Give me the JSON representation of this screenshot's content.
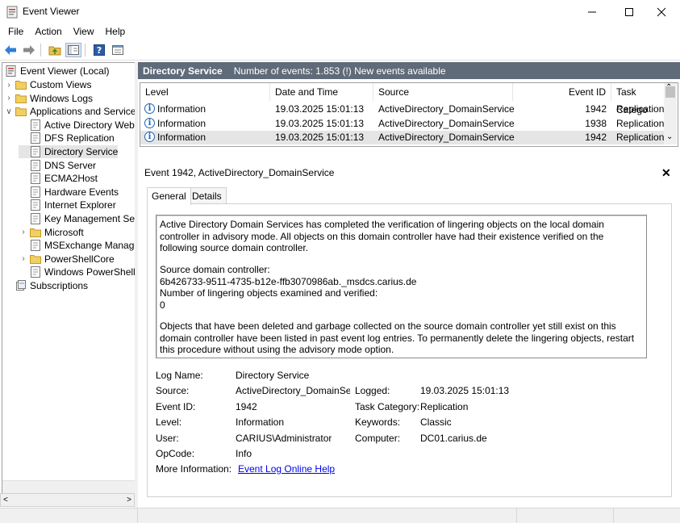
{
  "window": {
    "title": "Event Viewer"
  },
  "menu": [
    "File",
    "Action",
    "View",
    "Help"
  ],
  "tree": {
    "root": "Event Viewer (Local)",
    "items": [
      {
        "label": "Custom Views",
        "level": 1,
        "expander": ">"
      },
      {
        "label": "Windows Logs",
        "level": 1,
        "expander": ">"
      },
      {
        "label": "Applications and Services",
        "level": 1,
        "expander": "v"
      },
      {
        "label": "Active Directory Web",
        "level": 2,
        "expander": ""
      },
      {
        "label": "DFS Replication",
        "level": 2,
        "expander": ""
      },
      {
        "label": "Directory Service",
        "level": 2,
        "expander": "",
        "selected": true
      },
      {
        "label": "DNS Server",
        "level": 2,
        "expander": ""
      },
      {
        "label": "ECMA2Host",
        "level": 2,
        "expander": ""
      },
      {
        "label": "Hardware Events",
        "level": 2,
        "expander": ""
      },
      {
        "label": "Internet Explorer",
        "level": 2,
        "expander": ""
      },
      {
        "label": "Key Management Ser",
        "level": 2,
        "expander": ""
      },
      {
        "label": "Microsoft",
        "level": 2,
        "expander": ">"
      },
      {
        "label": "MSExchange Manage",
        "level": 2,
        "expander": ""
      },
      {
        "label": "PowerShellCore",
        "level": 2,
        "expander": ">"
      },
      {
        "label": "Windows PowerShell",
        "level": 2,
        "expander": ""
      },
      {
        "label": "Subscriptions",
        "level": 1,
        "expander": ""
      }
    ]
  },
  "log_header": {
    "title": "Directory Service",
    "count_text": "Number of events: 1.853 (!) New events available"
  },
  "list": {
    "columns": [
      "Level",
      "Date and Time",
      "Source",
      "Event ID",
      "Task Catego"
    ],
    "rows": [
      {
        "level": "Information",
        "date": "19.03.2025 15:01:13",
        "source": "ActiveDirectory_DomainService",
        "event_id": "1942",
        "task": "Replication"
      },
      {
        "level": "Information",
        "date": "19.03.2025 15:01:13",
        "source": "ActiveDirectory_DomainService",
        "event_id": "1938",
        "task": "Replication"
      },
      {
        "level": "Information",
        "date": "19.03.2025 15:01:13",
        "source": "ActiveDirectory_DomainService",
        "event_id": "1942",
        "task": "Replication"
      }
    ]
  },
  "detail": {
    "title": "Event 1942, ActiveDirectory_DomainService",
    "tabs": [
      "General",
      "Details"
    ],
    "description": {
      "p1": "Active Directory Domain Services has completed the verification of lingering objects on the local domain controller in advisory mode. All objects on this domain controller have had their existence verified on the following source domain controller.",
      "p2": "Source domain controller:\n6b426733-9511-4735-b12e-ffb3070986ab._msdcs.carius.de\nNumber of lingering objects examined and verified:\n0",
      "p3": "Objects that have been deleted and garbage collected on the source domain controller yet still exist on this domain controller have been listed in past event log entries. To permanently delete the lingering objects, restart this procedure without using the advisory mode option."
    },
    "props": {
      "log_name_label": "Log Name:",
      "log_name": "Directory Service",
      "source_label": "Source:",
      "source": "ActiveDirectory_DomainServ",
      "logged_label": "Logged:",
      "logged": "19.03.2025 15:01:13",
      "event_id_label": "Event ID:",
      "event_id": "1942",
      "task_label": "Task Category:",
      "task": "Replication",
      "level_label": "Level:",
      "level": "Information",
      "keywords_label": "Keywords:",
      "keywords": "Classic",
      "user_label": "User:",
      "user": "CARIUS\\Administrator",
      "computer_label": "Computer:",
      "computer": "DC01.carius.de",
      "opcode_label": "OpCode:",
      "opcode": "Info",
      "more_info_label": "More Information:",
      "more_info_link": "Event Log Online Help"
    }
  },
  "colors": {
    "header_bg": "#5f6b79",
    "selection": "#e5e5e5",
    "link": "#0000ee",
    "info": "#1e64b4"
  }
}
